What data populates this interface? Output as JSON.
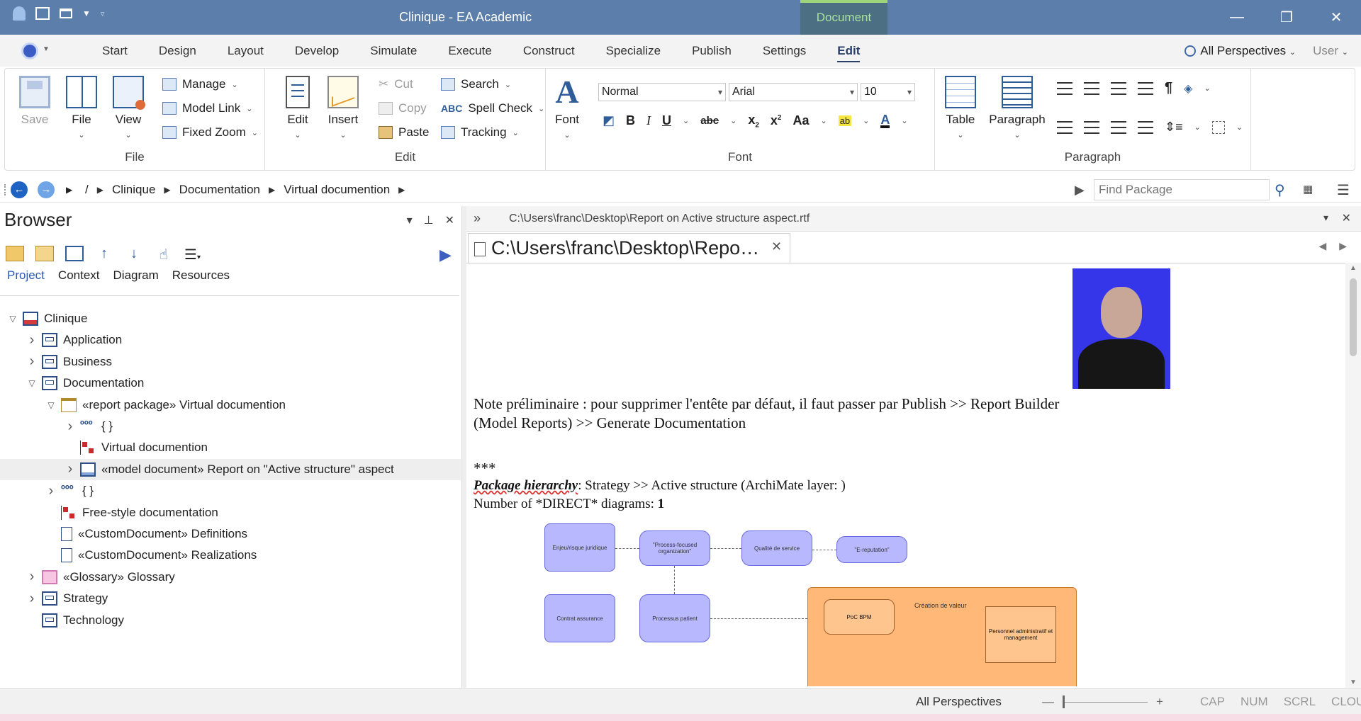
{
  "titlebar": {
    "title": "Clinique - EA Academic",
    "context_tab": "Document"
  },
  "menu": {
    "tabs": [
      "Start",
      "Design",
      "Layout",
      "Develop",
      "Simulate",
      "Execute",
      "Construct",
      "Specialize",
      "Publish",
      "Settings",
      "Edit"
    ],
    "active_tab": "Edit",
    "perspectives": "All Perspectives",
    "user": "User"
  },
  "ribbon": {
    "file_group": {
      "label": "File",
      "save": "Save",
      "file": "File",
      "view": "View",
      "manage": "Manage",
      "model_link": "Model Link",
      "fixed_zoom": "Fixed Zoom"
    },
    "edit_group": {
      "label": "Edit",
      "edit": "Edit",
      "insert": "Insert",
      "cut": "Cut",
      "copy": "Copy",
      "paste": "Paste",
      "search": "Search",
      "spell_check": "Spell Check",
      "tracking": "Tracking"
    },
    "font_group": {
      "label": "Font",
      "font": "Font",
      "style": "Normal",
      "family": "Arial",
      "size": "10"
    },
    "paragraph_group": {
      "label": "Paragraph",
      "table": "Table",
      "paragraph": "Paragraph"
    }
  },
  "address": {
    "root": "/",
    "crumbs": [
      "Clinique",
      "Documentation",
      "Virtual documention"
    ],
    "find_placeholder": "Find Package"
  },
  "browser": {
    "title": "Browser",
    "tabs": [
      "Project",
      "Context",
      "Diagram",
      "Resources"
    ],
    "active_tab": "Project",
    "tree": [
      {
        "label": "Clinique",
        "level": 0,
        "exp": "open",
        "icon": "model"
      },
      {
        "label": "Application",
        "level": 1,
        "exp": "closed",
        "icon": "package"
      },
      {
        "label": "Business",
        "level": 1,
        "exp": "closed",
        "icon": "package"
      },
      {
        "label": "Documentation",
        "level": 1,
        "exp": "open",
        "icon": "package"
      },
      {
        "label": "«report package» Virtual documention",
        "level": 2,
        "exp": "open",
        "icon": "folder"
      },
      {
        "label": "{ }",
        "level": 3,
        "exp": "closed",
        "icon": "dots"
      },
      {
        "label": "Virtual documention",
        "level": 3,
        "exp": "none",
        "icon": "hierarchy"
      },
      {
        "label": "«model document» Report on \"Active structure\" aspect",
        "level": 3,
        "exp": "closed",
        "icon": "document",
        "selected": true
      },
      {
        "label": "{ }",
        "level": 2,
        "exp": "closed",
        "icon": "dots"
      },
      {
        "label": "Free-style documentation",
        "level": 2,
        "exp": "none",
        "icon": "hierarchy"
      },
      {
        "label": "«CustomDocument» Definitions",
        "level": 2,
        "exp": "none",
        "icon": "page"
      },
      {
        "label": "«CustomDocument» Realizations",
        "level": 2,
        "exp": "none",
        "icon": "page"
      },
      {
        "label": "«Glossary» Glossary",
        "level": 1,
        "exp": "closed",
        "icon": "glossary"
      },
      {
        "label": "Strategy",
        "level": 1,
        "exp": "closed",
        "icon": "package"
      },
      {
        "label": "Technology",
        "level": 1,
        "exp": "none",
        "icon": "package"
      }
    ]
  },
  "document": {
    "path": "C:\\Users\\franc\\Desktop\\Report on Active structure aspect.rtf",
    "tab_label": "C:\\Users\\franc\\Desktop\\Repo…",
    "note_line1": "Note préliminaire : pour supprimer l'entête par défaut, il faut passer par Publish >> Report Builder",
    "note_line2": "(Model Reports) >> Generate Documentation",
    "stars": "***",
    "hierarchy_label": "Package hierarchy",
    "hierarchy_value": ": Strategy >> Active structure (ArchiMate layer: )",
    "direct_label": "Number of *DIRECT* diagrams: ",
    "direct_count": "1",
    "diagram": {
      "e1": "Enjeu/risque juridique",
      "e2": "\"Process-focused organization\"",
      "e3": "Qualité de service",
      "e4": "\"E-reputation\"",
      "e5": "Contrat assurance",
      "e6": "Processus patient",
      "group": "Création de valeur",
      "e7": "PoC BPM",
      "e8": "Personnel administratif et management"
    }
  },
  "status": {
    "perspectives": "All Perspectives",
    "indicators": [
      "CAP",
      "NUM",
      "SCRL",
      "CLOUD"
    ]
  },
  "colors": {
    "titlebar": "#5b7faa",
    "context_tab_bg": "#4d6f83",
    "context_tab_text": "#a6e39e",
    "archimate_motivation": "#b8b8ff",
    "archimate_group": "#ffb877"
  }
}
